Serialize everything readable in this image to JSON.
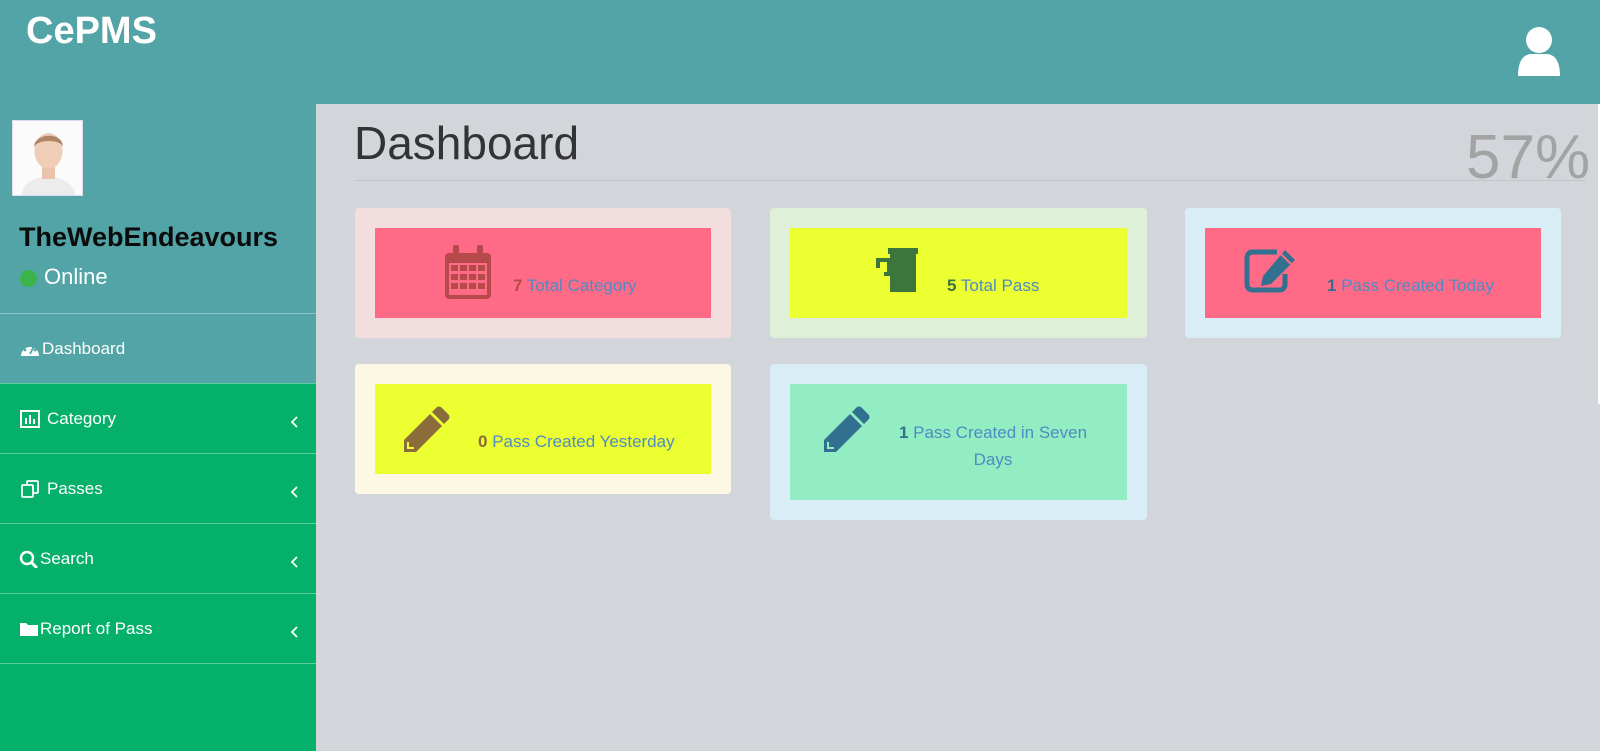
{
  "app": {
    "brand": "CePMS"
  },
  "sidebar": {
    "user": {
      "name": "TheWebEndeavours",
      "status": "Online"
    },
    "items": [
      {
        "label": "Dashboard",
        "icon": "dashboard-icon"
      },
      {
        "label": "Category",
        "icon": "bar-chart-icon"
      },
      {
        "label": "Passes",
        "icon": "copy-icon"
      },
      {
        "label": "Search",
        "icon": "search-icon"
      },
      {
        "label": "Report of Pass",
        "icon": "folder-icon"
      }
    ]
  },
  "main": {
    "title": "Dashboard",
    "overlay_text": "57%",
    "cards": [
      {
        "count": "7",
        "label": "Total Category",
        "icon": "calendar-icon",
        "outer": "#f2dede",
        "inner": "#ff6b86",
        "icon_color": "#b64a4a",
        "count_color": "#b64a4a"
      },
      {
        "count": "5",
        "label": "Total Pass",
        "icon": "beer-mug-icon",
        "outer": "#dff0d8",
        "inner": "#ecff31",
        "icon_color": "#3c763d",
        "count_color": "#3c763d"
      },
      {
        "count": "1",
        "label": "Pass Created Today",
        "icon": "edit-icon",
        "outer": "#d9edf7",
        "inner": "#ff6b86",
        "icon_color": "#31708f",
        "count_color": "#31708f"
      },
      {
        "count": "0",
        "label": "Pass Created Yesterday",
        "icon": "pencil-icon",
        "outer": "#fcf8e3",
        "inner": "#ecff31",
        "icon_color": "#8a6d3b",
        "count_color": "#8a6d3b"
      },
      {
        "count": "1",
        "label": "Pass Created in Seven Days",
        "icon": "pencil-icon",
        "outer": "#d9edf7",
        "inner": "#93edc2",
        "icon_color": "#31708f",
        "count_color": "#31708f"
      }
    ]
  },
  "colors": {
    "header": "#53a4a6",
    "sidebar": "#05b06b",
    "background": "#d2d6db"
  }
}
